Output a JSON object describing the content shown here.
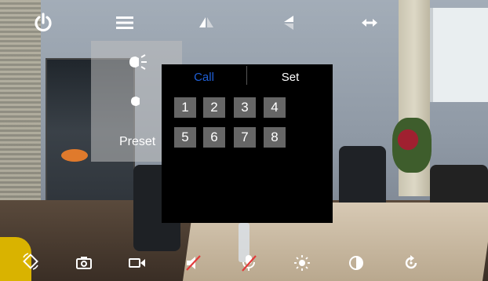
{
  "overlay_dialog": {
    "tabs": {
      "call": "Call",
      "set": "Set"
    },
    "presets": [
      "1",
      "2",
      "3",
      "4",
      "5",
      "6",
      "7",
      "8"
    ]
  },
  "side_panel": {
    "preset_label": "Preset"
  },
  "top_icons": [
    "power-icon",
    "menu-icon",
    "flip-vertical-icon",
    "mirror-left-icon",
    "horizontal-arrows-icon"
  ],
  "side_icons": [
    "light-on-icon",
    "light-off-icon"
  ],
  "bottom_icons": [
    "rotate-screen-icon",
    "snapshot-camera-icon",
    "video-record-icon",
    "speaker-muted-icon",
    "microphone-muted-icon",
    "brightness-icon",
    "contrast-icon",
    "refresh-icon"
  ],
  "colors": {
    "tab_active": "#1f5fd6",
    "dialog_bg": "#000000",
    "preset_button_bg": "#666666"
  }
}
